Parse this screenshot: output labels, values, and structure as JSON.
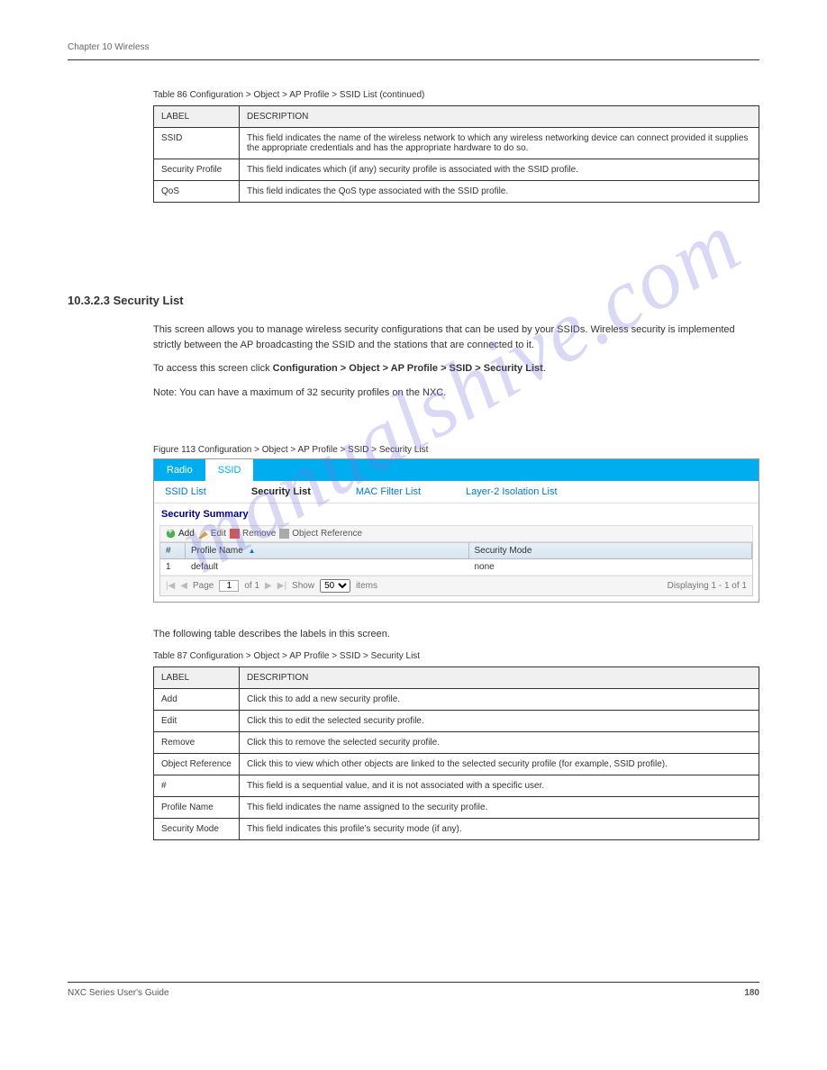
{
  "page_header": "Chapter 10 Wireless",
  "table86": {
    "caption": "Table 86   Configuration > Object > AP Profile > SSID List (continued)",
    "headers": [
      "LABEL",
      "DESCRIPTION"
    ],
    "rows": [
      {
        "label": "SSID",
        "desc": "This field indicates the name of the wireless network to which any wireless networking device can connect provided it supplies the appropriate credentials and has the appropriate hardware to do so."
      },
      {
        "label": "Security Profile",
        "desc": "This field indicates which (if any) security profile is associated with the SSID profile."
      },
      {
        "label": "QoS",
        "desc": "This field indicates the QoS type associated with the SSID profile."
      }
    ]
  },
  "section_heading_h3": "10.3.2.3  Security List",
  "intro_para1": "This screen allows you to manage wireless security configurations that can be used by your SSIDs. Wireless security is implemented strictly between the AP broadcasting the SSID and the stations that are connected to it.",
  "intro_para2_prefix": "To access this screen click ",
  "intro_para2_path": "Configuration > Object > AP Profile > SSID > Security List",
  "intro_para3_prefix": "Note: You can have a maximum of 32 security profiles on the ",
  "intro_para3_suffix": "NXC.",
  "figure_caption": "Figure 113   Configuration > Object > AP Profile > SSID > Security List",
  "figure": {
    "tabs": {
      "radio": "Radio",
      "ssid": "SSID"
    },
    "subtabs": {
      "ssid_list": "SSID List",
      "security_list": "Security List",
      "mac_filter": "MAC Filter List",
      "layer2": "Layer-2 Isolation List"
    },
    "section_title": "Security Summary",
    "toolbar": {
      "add": "Add",
      "edit": "Edit",
      "remove": "Remove",
      "object_ref": "Object Reference"
    },
    "grid": {
      "headers": {
        "num": "#",
        "profile": "Profile Name",
        "mode": "Security Mode"
      },
      "rows": [
        {
          "num": "1",
          "profile": "default",
          "mode": "none"
        }
      ]
    },
    "pager": {
      "page_label": "Page",
      "page_value": "1",
      "of_label": "of 1",
      "show_label": "Show",
      "show_value": "50",
      "items_label": "items",
      "display": "Displaying 1 - 1 of 1"
    }
  },
  "table_desc": "The following table describes the labels in this screen.",
  "table87": {
    "caption": "Table 87   Configuration > Object > AP Profile > SSID > Security List",
    "headers": [
      "LABEL",
      "DESCRIPTION"
    ],
    "rows": [
      {
        "label": "Add",
        "desc": "Click this to add a new security profile."
      },
      {
        "label": "Edit",
        "desc": "Click this to edit the selected security profile."
      },
      {
        "label": "Remove",
        "desc": "Click this to remove the selected security profile."
      },
      {
        "label": "Object Reference",
        "desc": "Click this to view which other objects are linked to the selected security profile (for example, SSID profile)."
      },
      {
        "label": "#",
        "desc": "This field is a sequential value, and it is not associated with a specific user."
      },
      {
        "label": "Profile Name",
        "desc": "This field indicates the name assigned to the security profile."
      },
      {
        "label": "Security Mode",
        "desc": "This field indicates this profile's security mode (if any)."
      }
    ]
  },
  "watermark": "manualshive.com",
  "footer": {
    "left": "NXC Series User's Guide",
    "right": "180"
  }
}
